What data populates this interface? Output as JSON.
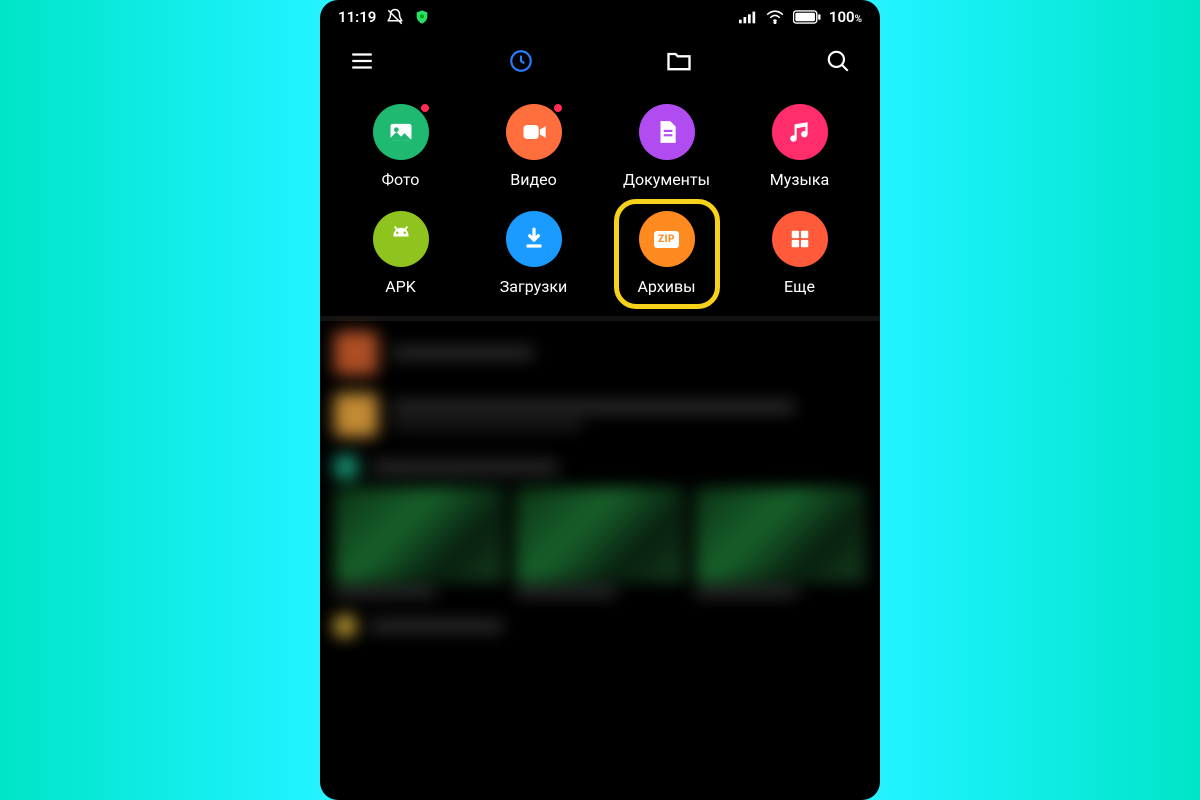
{
  "status": {
    "time": "11:19",
    "battery_text": "100",
    "battery_unit": "%"
  },
  "topnav": {
    "menu_icon": "menu",
    "recent_icon": "clock",
    "folder_icon": "folder",
    "search_icon": "search",
    "active_tab": "recent"
  },
  "categories": [
    {
      "id": "photo",
      "label": "Фото",
      "color": "c-green",
      "icon": "image",
      "badge": true
    },
    {
      "id": "video",
      "label": "Видео",
      "color": "c-orange",
      "icon": "video",
      "badge": true
    },
    {
      "id": "docs",
      "label": "Документы",
      "color": "c-purple",
      "icon": "doc",
      "badge": false
    },
    {
      "id": "music",
      "label": "Музыка",
      "color": "c-pink",
      "icon": "music",
      "badge": false
    },
    {
      "id": "apk",
      "label": "APK",
      "color": "c-lime",
      "icon": "android",
      "badge": false
    },
    {
      "id": "downloads",
      "label": "Загрузки",
      "color": "c-blue",
      "icon": "download",
      "badge": false
    },
    {
      "id": "archives",
      "label": "Архивы",
      "color": "c-amber",
      "icon": "zip",
      "badge": false,
      "highlighted": true,
      "zip_text": "ZIP"
    },
    {
      "id": "more",
      "label": "Еще",
      "color": "c-coral",
      "icon": "grid",
      "badge": false
    }
  ]
}
